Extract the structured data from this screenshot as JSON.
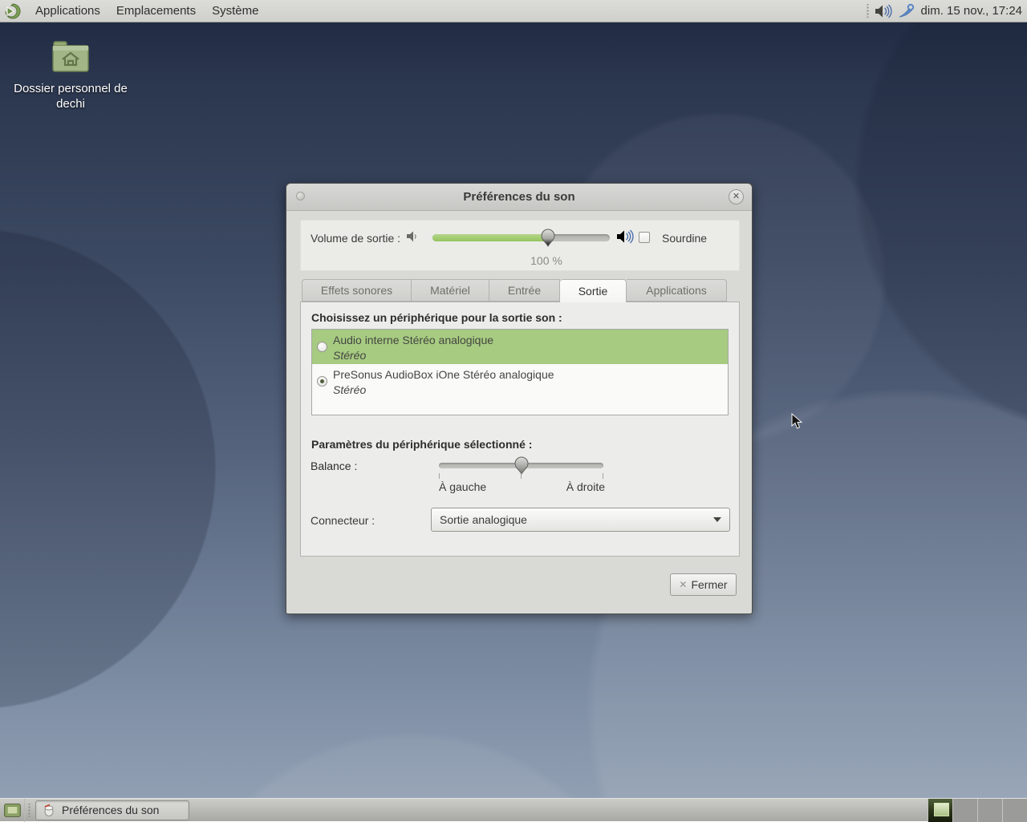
{
  "top_panel": {
    "menus": [
      {
        "label": "Applications"
      },
      {
        "label": "Emplacements"
      },
      {
        "label": "Système"
      }
    ],
    "clock": "dim. 15 nov., 17:24"
  },
  "desktop": {
    "home_icon_label": "Dossier personnel de dechi"
  },
  "sound_dialog": {
    "title": "Préférences du son",
    "output_volume_label": "Volume de sortie :",
    "output_volume_value": "100 %",
    "mute_label": "Sourdine",
    "tabs": [
      {
        "label": "Effets sonores"
      },
      {
        "label": "Matériel"
      },
      {
        "label": "Entrée"
      },
      {
        "label": "Sortie"
      },
      {
        "label": "Applications"
      }
    ],
    "active_tab": "Sortie",
    "choose_device_label": "Choisissez un périphérique pour la sortie son :",
    "devices": [
      {
        "name": "Audio interne Stéréo analogique",
        "profile": "Stéréo"
      },
      {
        "name": "PreSonus AudioBox iOne Stéréo analogique",
        "profile": "Stéréo"
      }
    ],
    "selected_device_params_label": "Paramètres du périphérique sélectionné :",
    "balance_label": "Balance :",
    "balance_left_label": "À gauche",
    "balance_right_label": "À droite",
    "connector_label": "Connecteur :",
    "connector_value": "Sortie analogique",
    "close_button_label": "Fermer"
  },
  "taskbar": {
    "task_button_label": "Préférences du son"
  },
  "colors": {
    "selection_green": "#a6cb81",
    "volume_fill_green": "#94c45e",
    "desktop_top": "#1e2840",
    "desktop_bottom": "#95a3b6"
  }
}
